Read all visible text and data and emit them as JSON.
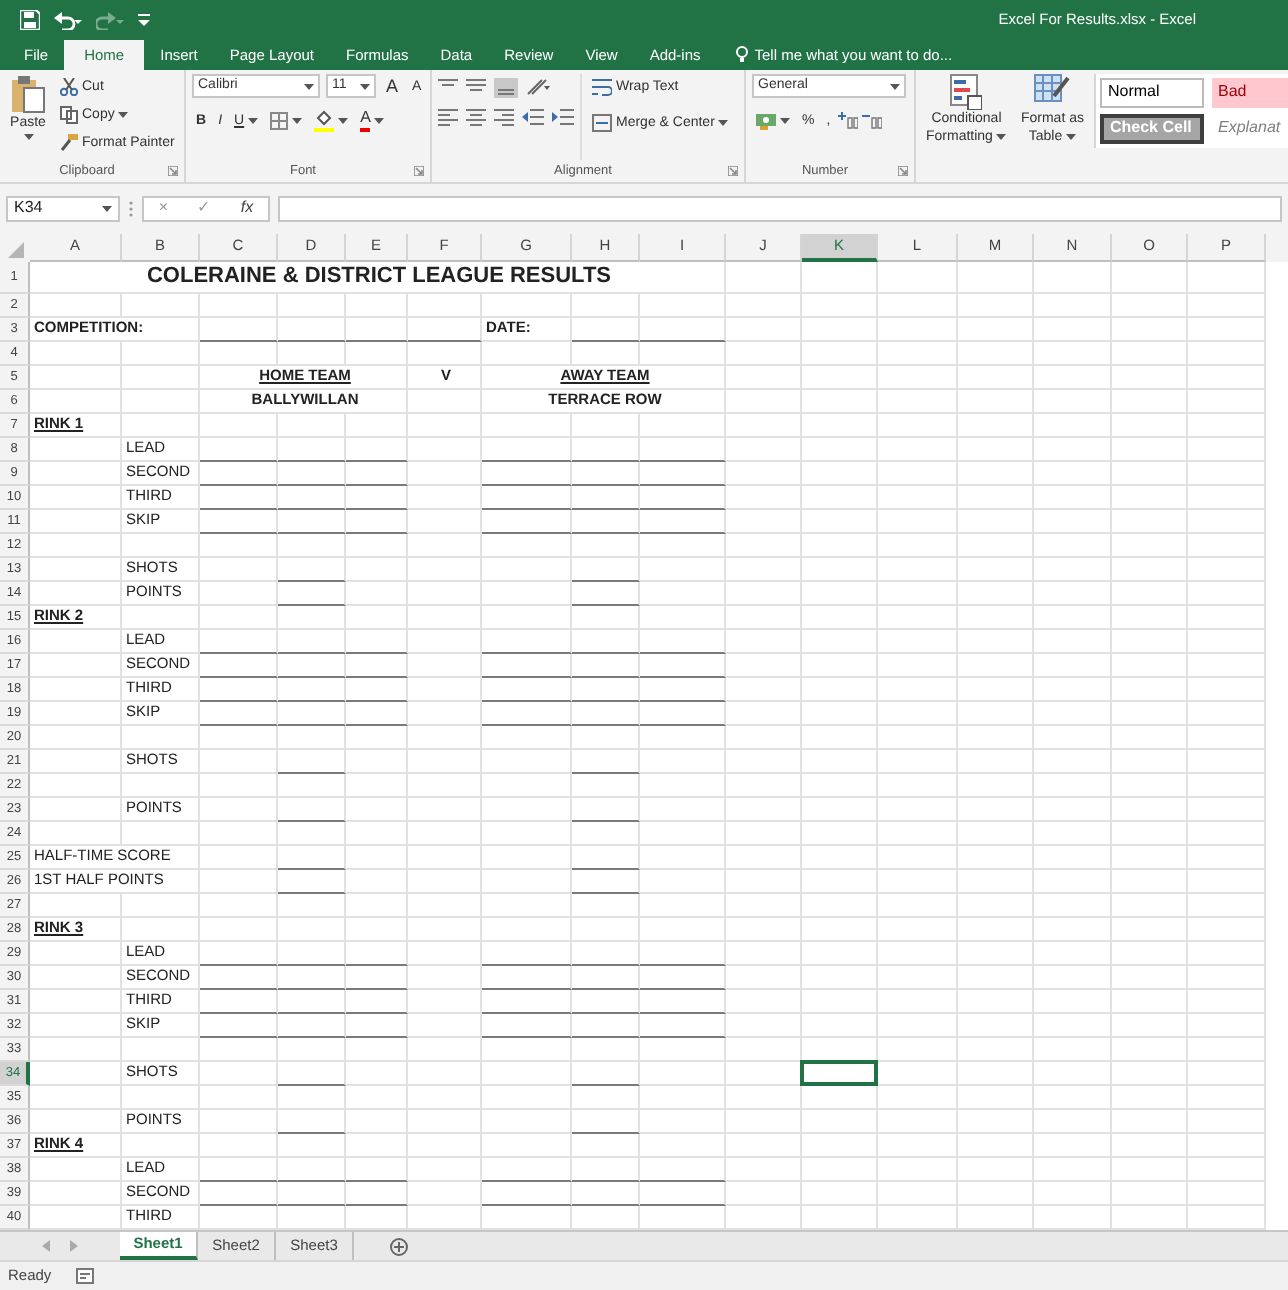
{
  "window": {
    "title": "Excel For Results.xlsx - Excel"
  },
  "quick_access": [
    {
      "kind": "save",
      "disabled": false
    },
    {
      "kind": "undo",
      "disabled": false
    },
    {
      "kind": "redo",
      "disabled": true
    },
    {
      "kind": "customize",
      "disabled": false
    }
  ],
  "ribbon_tabs": [
    {
      "label": "File",
      "selected": false
    },
    {
      "label": "Home",
      "selected": true
    },
    {
      "label": "Insert",
      "selected": false
    },
    {
      "label": "Page Layout",
      "selected": false
    },
    {
      "label": "Formulas",
      "selected": false
    },
    {
      "label": "Data",
      "selected": false
    },
    {
      "label": "Review",
      "selected": false
    },
    {
      "label": "View",
      "selected": false
    },
    {
      "label": "Add-ins",
      "selected": false
    }
  ],
  "tell_me": {
    "placeholder": "Tell me what you want to do..."
  },
  "clipboard": {
    "paste": "Paste",
    "cut": "Cut",
    "copy": "Copy",
    "format_painter": "Format Painter",
    "label": "Clipboard"
  },
  "font": {
    "name": "Calibri",
    "size": "11",
    "grow": "A",
    "shrink": "A",
    "bold": "B",
    "italic": "I",
    "underline": "U",
    "font_color": "A",
    "label": "Font"
  },
  "alignment": {
    "wrap_text": "Wrap Text",
    "merge_center": "Merge & Center",
    "label": "Alignment"
  },
  "number": {
    "format": "General",
    "percent": "%",
    "comma": ",",
    "label": "Number"
  },
  "styles": {
    "conditional_formatting": [
      "Conditional",
      "Formatting"
    ],
    "format_as_table": [
      "Format as",
      "Table"
    ],
    "cell_styles": [
      {
        "label": "Normal",
        "kind": "normal"
      },
      {
        "label": "Bad",
        "kind": "bad"
      },
      {
        "label": "Check Cell",
        "kind": "check"
      },
      {
        "label": "Explanat",
        "kind": "explanatory"
      }
    ]
  },
  "formula_bar": {
    "name_box": "K34",
    "cancel": "×",
    "enter": "✓",
    "function": "fx"
  },
  "columns": [
    {
      "label": "A",
      "selected": false
    },
    {
      "label": "B",
      "selected": false
    },
    {
      "label": "C",
      "selected": false
    },
    {
      "label": "D",
      "selected": false
    },
    {
      "label": "E",
      "selected": false
    },
    {
      "label": "F",
      "selected": false
    },
    {
      "label": "G",
      "selected": false
    },
    {
      "label": "H",
      "selected": false
    },
    {
      "label": "I",
      "selected": false
    },
    {
      "label": "J",
      "selected": false
    },
    {
      "label": "K",
      "selected": true
    },
    {
      "label": "L",
      "selected": false
    },
    {
      "label": "M",
      "selected": false
    },
    {
      "label": "N",
      "selected": false
    },
    {
      "label": "O",
      "selected": false
    },
    {
      "label": "P",
      "selected": false
    }
  ],
  "rows": [
    {
      "number": "1",
      "selected": false,
      "kind": "title",
      "text": "COLERAINE & DISTRICT LEAGUE RESULTS"
    },
    {
      "number": "2",
      "selected": false,
      "kind": "blank"
    },
    {
      "number": "3",
      "selected": false,
      "kind": "competition",
      "label": "COMPETITION:",
      "date_label": "DATE:"
    },
    {
      "number": "4",
      "selected": false,
      "kind": "blank"
    },
    {
      "number": "5",
      "selected": false,
      "kind": "team_headings",
      "home": "HOME TEAM",
      "versus": "V",
      "away": "AWAY TEAM"
    },
    {
      "number": "6",
      "selected": false,
      "kind": "teams",
      "home": "BALLYWILLAN",
      "away": "TERRACE ROW"
    },
    {
      "number": "7",
      "selected": false,
      "kind": "section",
      "text": "RINK 1"
    },
    {
      "number": "8",
      "selected": false,
      "kind": "position",
      "text": "LEAD",
      "lines": true
    },
    {
      "number": "9",
      "selected": false,
      "kind": "position",
      "text": "SECOND",
      "lines": true
    },
    {
      "number": "10",
      "selected": false,
      "kind": "position",
      "text": "THIRD",
      "lines": true
    },
    {
      "number": "11",
      "selected": false,
      "kind": "position",
      "text": "SKIP",
      "lines": true
    },
    {
      "number": "12",
      "selected": false,
      "kind": "blank"
    },
    {
      "number": "13",
      "selected": false,
      "kind": "score",
      "text": "SHOTS"
    },
    {
      "number": "14",
      "selected": false,
      "kind": "score",
      "text": "POINTS"
    },
    {
      "number": "15",
      "selected": false,
      "kind": "section",
      "text": "RINK 2"
    },
    {
      "number": "16",
      "selected": false,
      "kind": "position",
      "text": "LEAD",
      "lines": true
    },
    {
      "number": "17",
      "selected": false,
      "kind": "position",
      "text": "SECOND",
      "lines": true
    },
    {
      "number": "18",
      "selected": false,
      "kind": "position",
      "text": "THIRD",
      "lines": true
    },
    {
      "number": "19",
      "selected": false,
      "kind": "position",
      "text": "SKIP",
      "lines": true
    },
    {
      "number": "20",
      "selected": false,
      "kind": "blank"
    },
    {
      "number": "21",
      "selected": false,
      "kind": "score",
      "text": "SHOTS"
    },
    {
      "number": "22",
      "selected": false,
      "kind": "blank"
    },
    {
      "number": "23",
      "selected": false,
      "kind": "score",
      "text": "POINTS"
    },
    {
      "number": "24",
      "selected": false,
      "kind": "blank"
    },
    {
      "number": "25",
      "selected": false,
      "kind": "summary",
      "text": "HALF-TIME SCORE"
    },
    {
      "number": "26",
      "selected": false,
      "kind": "summary",
      "text": "1ST HALF POINTS"
    },
    {
      "number": "27",
      "selected": false,
      "kind": "blank"
    },
    {
      "number": "28",
      "selected": false,
      "kind": "section",
      "text": "RINK 3"
    },
    {
      "number": "29",
      "selected": false,
      "kind": "position",
      "text": "LEAD",
      "lines": true
    },
    {
      "number": "30",
      "selected": false,
      "kind": "position",
      "text": "SECOND",
      "lines": true
    },
    {
      "number": "31",
      "selected": false,
      "kind": "position",
      "text": "THIRD",
      "lines": true
    },
    {
      "number": "32",
      "selected": false,
      "kind": "position",
      "text": "SKIP",
      "lines": true
    },
    {
      "number": "33",
      "selected": false,
      "kind": "blank"
    },
    {
      "number": "34",
      "selected": true,
      "kind": "score",
      "text": "SHOTS"
    },
    {
      "number": "35",
      "selected": false,
      "kind": "blank"
    },
    {
      "number": "36",
      "selected": false,
      "kind": "score",
      "text": "POINTS"
    },
    {
      "number": "37",
      "selected": false,
      "kind": "section",
      "text": "RINK 4"
    },
    {
      "number": "38",
      "selected": false,
      "kind": "position",
      "text": "LEAD",
      "lines": true
    },
    {
      "number": "39",
      "selected": false,
      "kind": "position",
      "text": "SECOND",
      "lines": true
    },
    {
      "number": "40",
      "selected": false,
      "kind": "position",
      "text": "THIRD",
      "lines": false
    }
  ],
  "sheet_tabs": [
    {
      "label": "Sheet1",
      "selected": true
    },
    {
      "label": "Sheet2",
      "selected": false
    },
    {
      "label": "Sheet3",
      "selected": false
    }
  ],
  "status_bar": {
    "text": "Ready"
  }
}
